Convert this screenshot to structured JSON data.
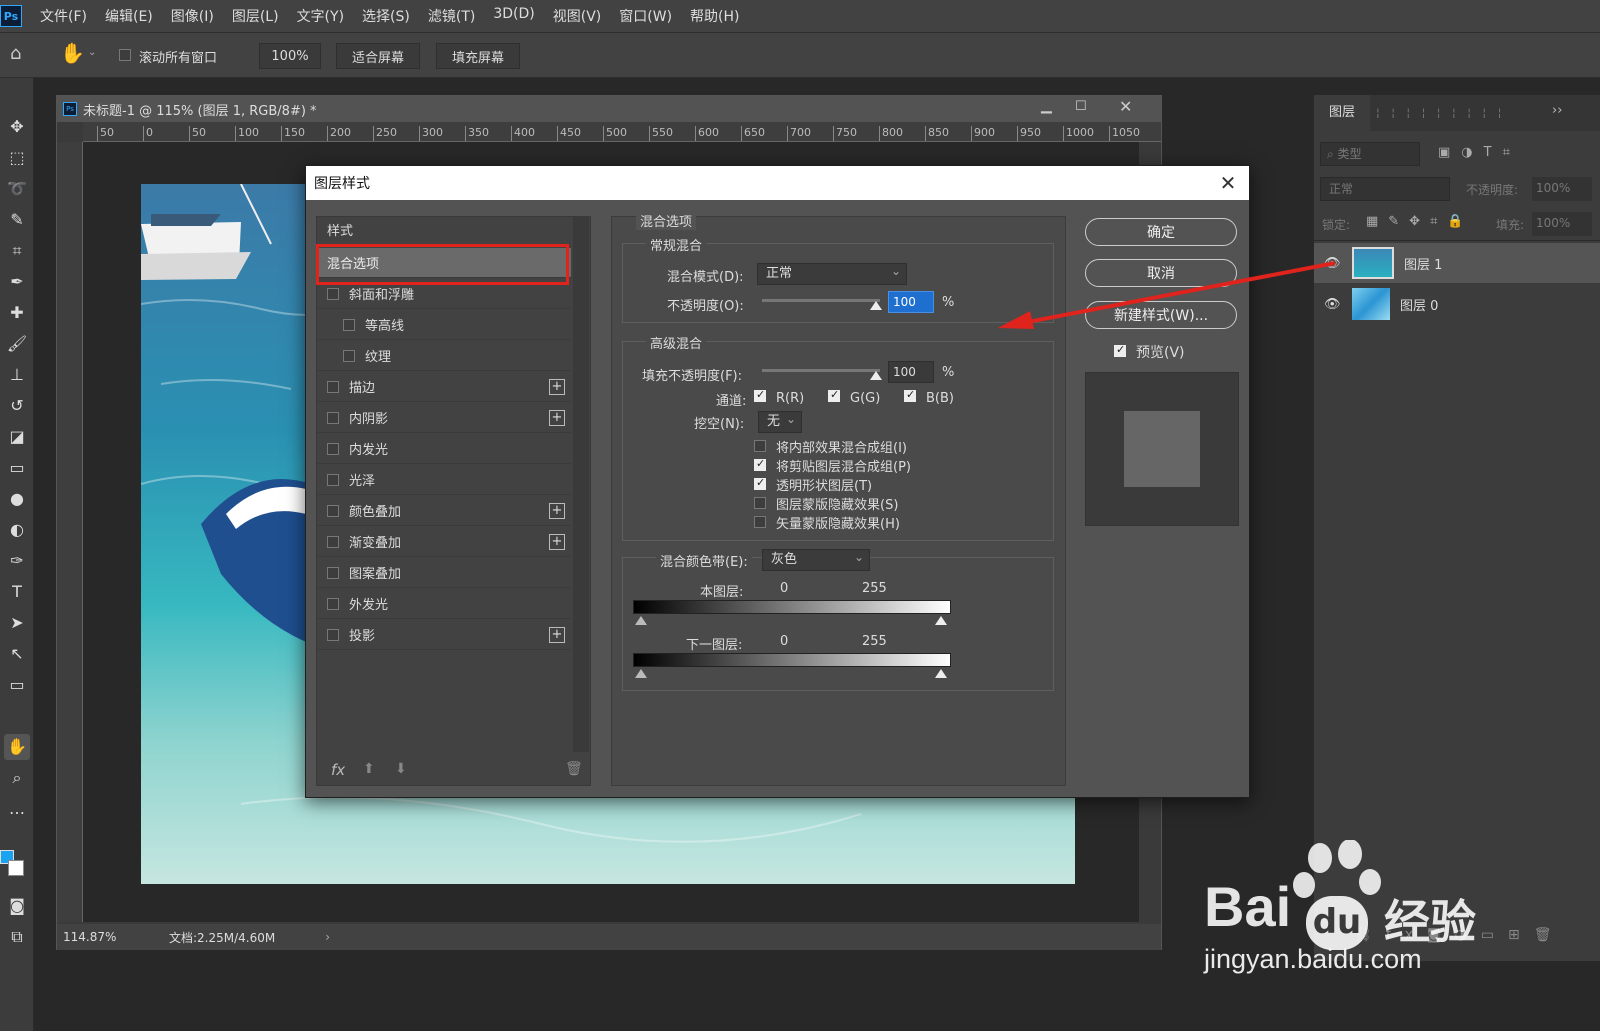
{
  "app": {
    "logo": "Ps",
    "menus": [
      "文件(F)",
      "编辑(E)",
      "图像(I)",
      "图层(L)",
      "文字(Y)",
      "选择(S)",
      "滤镜(T)",
      "3D(D)",
      "视图(V)",
      "窗口(W)",
      "帮助(H)"
    ]
  },
  "options": {
    "scroll_all": "滚动所有窗口",
    "zoom": "100%",
    "fit_screen": "适合屏幕",
    "fill_screen": "填充屏幕"
  },
  "document": {
    "title": "未标题-1 @ 115% (图层 1, RGB/8#) *",
    "ruler_h": [
      "50",
      "0",
      "50",
      "100",
      "150",
      "200",
      "250",
      "300",
      "350",
      "400",
      "450",
      "500",
      "550",
      "600",
      "650",
      "700",
      "750",
      "800",
      "850",
      "900",
      "950",
      "1000",
      "1050"
    ],
    "status_zoom": "114.87%",
    "status_doc": "文档:2.25M/4.60M"
  },
  "layers_panel": {
    "tab": "图层",
    "filter": "类型",
    "blend": "正常",
    "opacity_label": "不透明度:",
    "opacity": "100%",
    "lock_label": "锁定:",
    "fill_label": "填充:",
    "fill": "100%",
    "layers": [
      {
        "name": "图层 1"
      },
      {
        "name": "图层 0"
      }
    ]
  },
  "dialog": {
    "title": "图层样式",
    "styles_header": "样式",
    "items": [
      {
        "label": "混合选项",
        "checkbox": false,
        "plus": false,
        "selected": true
      },
      {
        "label": "斜面和浮雕",
        "checkbox": true,
        "plus": false
      },
      {
        "label": "等高线",
        "checkbox": true,
        "plus": false,
        "indent": true
      },
      {
        "label": "纹理",
        "checkbox": true,
        "plus": false,
        "indent": true
      },
      {
        "label": "描边",
        "checkbox": true,
        "plus": true
      },
      {
        "label": "内阴影",
        "checkbox": true,
        "plus": true
      },
      {
        "label": "内发光",
        "checkbox": true,
        "plus": false
      },
      {
        "label": "光泽",
        "checkbox": true,
        "plus": false
      },
      {
        "label": "颜色叠加",
        "checkbox": true,
        "plus": true
      },
      {
        "label": "渐变叠加",
        "checkbox": true,
        "plus": true
      },
      {
        "label": "图案叠加",
        "checkbox": true,
        "plus": false
      },
      {
        "label": "外发光",
        "checkbox": true,
        "plus": false
      },
      {
        "label": "投影",
        "checkbox": true,
        "plus": true
      }
    ],
    "blend_options": "混合选项",
    "general": "常规混合",
    "blend_mode_label": "混合模式(D):",
    "blend_mode": "正常",
    "opacity_label": "不透明度(O):",
    "opacity": "100",
    "pct": "%",
    "advanced": "高级混合",
    "fill_label": "填充不透明度(F):",
    "fill": "100",
    "channels_label": "通道:",
    "r": "R(R)",
    "g": "G(G)",
    "b": "B(B)",
    "knockout_label": "挖空(N):",
    "knockout": "无",
    "adv_opts": [
      {
        "label": "将内部效果混合成组(I)",
        "on": false
      },
      {
        "label": "将剪贴图层混合成组(P)",
        "on": true
      },
      {
        "label": "透明形状图层(T)",
        "on": true
      },
      {
        "label": "图层蒙版隐藏效果(S)",
        "on": false
      },
      {
        "label": "矢量蒙版隐藏效果(H)",
        "on": false
      }
    ],
    "blend_if_label": "混合颜色带(E):",
    "blend_if": "灰色",
    "this_layer": "本图层:",
    "under_layer": "下一图层:",
    "v0": "0",
    "v255": "255",
    "ok": "确定",
    "cancel": "取消",
    "new_style": "新建样式(W)...",
    "preview": "预览(V)",
    "fx": "fx"
  },
  "watermark": {
    "brand": "Bai",
    "du": "du",
    "cn": "经验",
    "url": "jingyan.baidu.com"
  },
  "colors": {
    "highlight": "#e0231c",
    "fg_swatch": "#1aa3f0"
  }
}
